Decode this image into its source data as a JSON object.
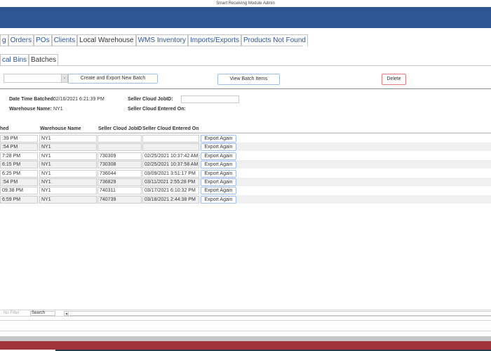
{
  "window": {
    "title": "Smart Receiving Module Admin"
  },
  "colors": {
    "banner": "#2e5594",
    "tab_text": "#2e5594",
    "delete_border": "#e08080",
    "footer_red": "#a1343a"
  },
  "main_tabs": [
    {
      "label": "g",
      "active": false
    },
    {
      "label": "Orders",
      "active": false
    },
    {
      "label": "POs",
      "active": false
    },
    {
      "label": "Clients",
      "active": false
    },
    {
      "label": "Local Warehouse",
      "active": true
    },
    {
      "label": "WMS Inventory",
      "active": false
    },
    {
      "label": "Imports/Exports",
      "active": false
    },
    {
      "label": "Products Not Found",
      "active": false
    }
  ],
  "sub_tabs": [
    {
      "label": "cal Bins",
      "active": false
    },
    {
      "label": "Batches",
      "active": true
    }
  ],
  "toolbar": {
    "batch_combo_value": "",
    "create_export_label": "Create and Export New Batch",
    "view_items_label": "View Batch Items",
    "delete_label": "Delete"
  },
  "detail": {
    "date_time_batched_label": "Date Time Batched:",
    "date_time_batched_value": "02/16/2021 6:21:39 PM",
    "warehouse_name_label": "Warehouse Name:",
    "warehouse_name_value": "NY1",
    "seller_cloud_jobid_label": "Seller Cloud JobID:",
    "seller_cloud_jobid_value": "",
    "seller_cloud_entered_label": "Seller Cloud Entered On:",
    "seller_cloud_entered_value": ""
  },
  "grid": {
    "columns": [
      "hed",
      "Warehouse Name",
      "Seller Cloud JobID",
      "Seller Cloud Entered On"
    ],
    "row_button_label": "Export Again",
    "rows": [
      {
        "batched": ":39 PM",
        "warehouse": "NY1",
        "jobid": "",
        "entered": ""
      },
      {
        "batched": ":54 PM",
        "warehouse": "NY1",
        "jobid": "",
        "entered": ""
      },
      {
        "batched": "7:28 PM",
        "warehouse": "NY1",
        "jobid": "730309",
        "entered": "02/25/2021 10:37:42 AM"
      },
      {
        "batched": "6:15 PM",
        "warehouse": "NY1",
        "jobid": "730308",
        "entered": "02/25/2021 10:37:58 AM"
      },
      {
        "batched": "6:25 PM",
        "warehouse": "NY1",
        "jobid": "736044",
        "entered": "03/09/2021 3:51:17 PM"
      },
      {
        "batched": ":54 PM",
        "warehouse": "NY1",
        "jobid": "736829",
        "entered": "03/11/2021 2:55:28 PM"
      },
      {
        "batched": "09:38 PM",
        "warehouse": "NY1",
        "jobid": "740311",
        "entered": "03/17/2021 6:10:32 PM"
      },
      {
        "batched": "6:59 PM",
        "warehouse": "NY1",
        "jobid": "740739",
        "entered": "03/18/2021 2:44:38 PM"
      }
    ]
  },
  "navigation": {
    "filter_label": "No Filter",
    "search_placeholder": "Search"
  }
}
